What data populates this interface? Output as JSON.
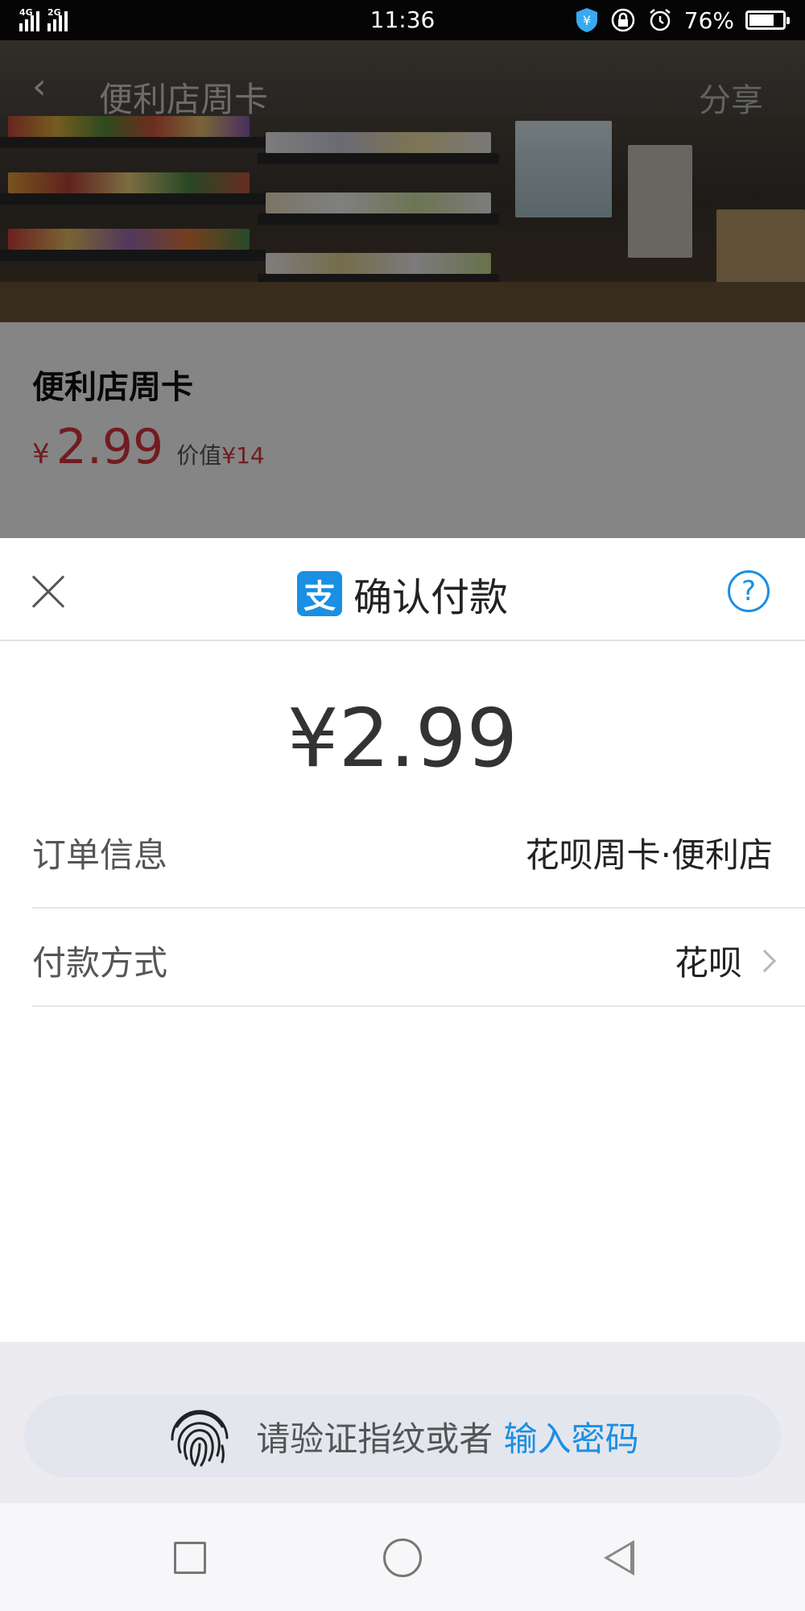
{
  "status_bar": {
    "signal1_label": "4G",
    "signal2_label": "2G",
    "time": "11:36",
    "battery_percent": "76%",
    "battery_level": 0.76,
    "icons": [
      "alipay-shield-icon",
      "lock-rotation-icon",
      "alarm-icon",
      "battery-icon"
    ]
  },
  "background_page": {
    "header_title": "便利店周卡",
    "share_label": "分享",
    "product_name": "便利店周卡",
    "price_symbol": "¥",
    "price": "2.99",
    "worth_label": "价值",
    "worth_value": "¥14"
  },
  "payment_sheet": {
    "logo_char": "支",
    "title": "确认付款",
    "help_label": "?",
    "amount": "¥2.99",
    "rows": [
      {
        "label": "订单信息",
        "value": "花呗周卡·便利店"
      },
      {
        "label": "付款方式",
        "value": "花呗"
      }
    ],
    "verify_prompt": "请验证指纹或者",
    "verify_link": "输入密码"
  },
  "colors": {
    "accent": "#1a8fe3",
    "price": "#d9363e",
    "status_bar": "#050505"
  }
}
